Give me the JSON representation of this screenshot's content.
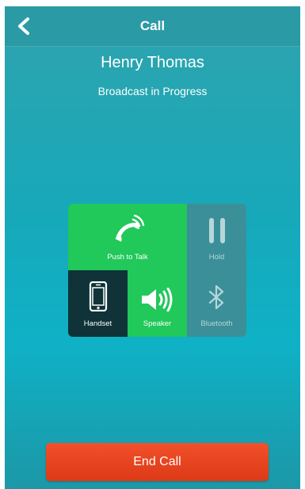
{
  "nav": {
    "title": "Call",
    "back_icon": "chevron-left-icon"
  },
  "call": {
    "caller_name": "Henry Thomas",
    "status": "Broadcast in Progress"
  },
  "controls": {
    "push_to_talk": {
      "label": "Push to Talk",
      "icon": "phone-icon",
      "active": true
    },
    "hold": {
      "label": "Hold",
      "icon": "pause-icon",
      "active": false
    },
    "handset": {
      "label": "Handset",
      "icon": "phone-device-icon",
      "active": false
    },
    "speaker": {
      "label": "Speaker",
      "icon": "speaker-icon",
      "active": true
    },
    "bluetooth": {
      "label": "Bluetooth",
      "icon": "bluetooth-icon",
      "active": false
    }
  },
  "end_call": {
    "label": "End Call"
  },
  "colors": {
    "background": "#16a9bb",
    "active_green": "#21c85a",
    "disabled_teal": "#3b8f98",
    "handset_dark": "#0f3338",
    "end_call_red": "#e8411c"
  }
}
